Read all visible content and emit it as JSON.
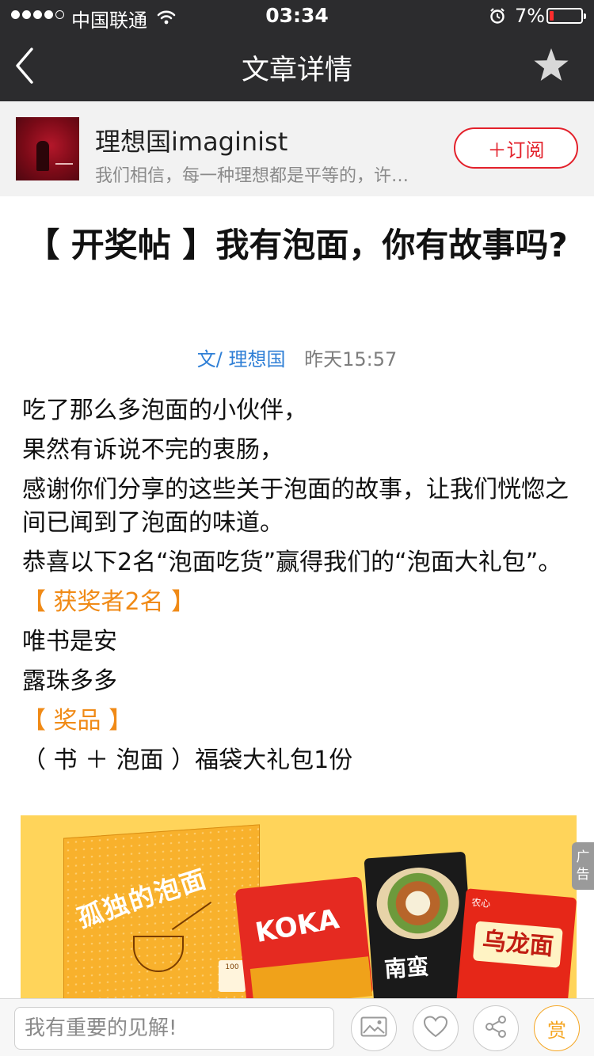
{
  "status_bar": {
    "carrier": "中国联通",
    "time": "03:34",
    "battery": "7%",
    "signal_bars_filled": 4,
    "signal_bars_total": 5
  },
  "nav": {
    "title": "文章详情",
    "back_icon": "back-chevron-icon",
    "favorite_icon": "star-icon"
  },
  "account": {
    "name": "理想国imaginist",
    "description": "我们相信，每一种理想都是平等的，许…",
    "subscribe_label": "＋订阅"
  },
  "article": {
    "title": "【 开奖帖 】我有泡面，你有故事吗?",
    "author": "文/ 理想国",
    "date": "昨天15:57",
    "paragraphs": [
      "吃了那么多泡面的小伙伴，",
      "果然有诉说不完的衷肠，",
      "感谢你们分享的这些关于泡面的故事，让我们恍惚之间已闻到了泡面的味道。",
      "恭喜以下2名“泡面吃货”赢得我们的“泡面大礼包”。",
      "【 获奖者2名 】",
      "唯书是安",
      "露珠多多",
      "【 奖品 】",
      "（ 书 ＋ 泡面 ）福袋大礼包1份"
    ]
  },
  "banner": {
    "book_title": "孤独的泡面",
    "pack1_brand": "KOKA",
    "pack2_text": "南蛮",
    "pack3_text": "乌龙面",
    "pack3_brand": "农心",
    "ad_label": "广告"
  },
  "bottom_bar": {
    "comment_placeholder": "我有重要的见解!",
    "reward_label": "赏"
  },
  "colors": {
    "nav_bg": "#2c2c2e",
    "accent_red": "#e3212b",
    "link_blue": "#2f7fd6",
    "highlight_orange": "#f08a16",
    "reward_orange": "#f5a623"
  }
}
